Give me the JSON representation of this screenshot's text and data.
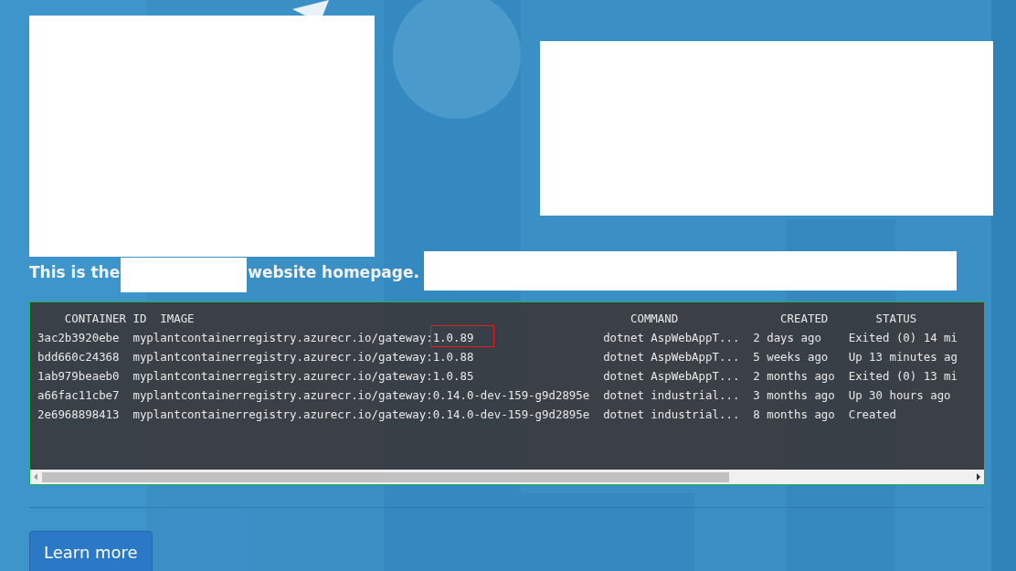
{
  "heading": {
    "before": "This is the",
    "after": "website homepage."
  },
  "terminal": {
    "columns": [
      "CONTAINER ID",
      "IMAGE",
      "COMMAND",
      "CREATED",
      "STATUS"
    ],
    "rows": [
      {
        "cells": [
          "3ac2b3920ebe",
          "myplantcontainerregistry.azurecr.io/gateway:1.0.89",
          "dotnet AspWebAppT...",
          "2 days ago",
          "Exited (0) 14 mi"
        ],
        "highlighted": true
      },
      {
        "cells": [
          "bdd660c24368",
          "myplantcontainerregistry.azurecr.io/gateway:1.0.88",
          "dotnet AspWebAppT...",
          "5 weeks ago",
          "Up 13 minutes ag"
        ],
        "highlighted": false
      },
      {
        "cells": [
          "1ab979beaeb0",
          "myplantcontainerregistry.azurecr.io/gateway:1.0.85",
          "dotnet AspWebAppT...",
          "2 months ago",
          "Exited (0) 13 mi"
        ],
        "highlighted": false
      },
      {
        "cells": [
          "a66fac11cbe7",
          "myplantcontainerregistry.azurecr.io/gateway:0.14.0-dev-159-g9d2895e",
          "dotnet industrial...",
          "3 months ago",
          "Up 30 hours ago"
        ],
        "highlighted": false
      },
      {
        "cells": [
          "2e6968898413",
          "myplantcontainerregistry.azurecr.io/gateway:0.14.0-dev-159-g9d2895e",
          "dotnet industrial...",
          "8 months ago",
          "Created"
        ],
        "highlighted": false
      }
    ]
  },
  "button": {
    "label": "Learn more"
  }
}
